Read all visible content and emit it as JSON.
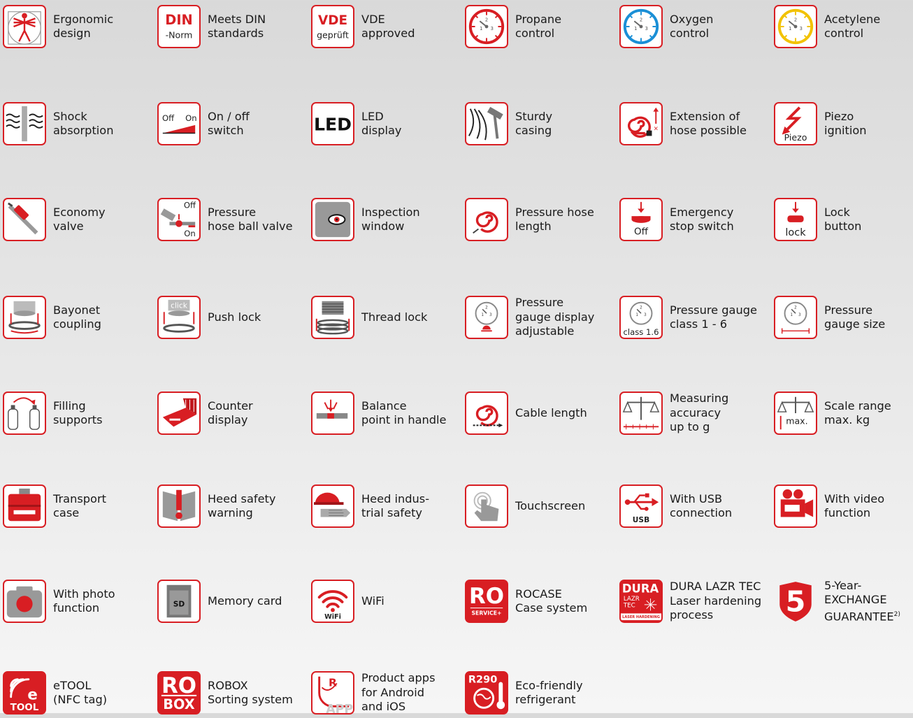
{
  "brand_color": "#d81e23",
  "features": [
    {
      "label": "Ergonomic\ndesign",
      "icon": "ergonomic-figure-icon"
    },
    {
      "label": "Meets DIN\nstandards",
      "icon": "din-norm-icon",
      "icon_text": [
        "DIN",
        "-Norm"
      ]
    },
    {
      "label": "VDE\napproved",
      "icon": "vde-icon",
      "icon_text": [
        "VDE",
        "geprüft"
      ]
    },
    {
      "label": "Propane\ncontrol",
      "icon": "propane-gauge-icon",
      "icon_color": "#d81e23"
    },
    {
      "label": "Oxygen\ncontrol",
      "icon": "oxygen-gauge-icon",
      "icon_color": "#1a8fd6"
    },
    {
      "label": "Acetylene\ncontrol",
      "icon": "acetylene-gauge-icon",
      "icon_color": "#f2c200"
    },
    {
      "label": "Shock\nabsorption",
      "icon": "shock-absorption-icon"
    },
    {
      "label": "On / off\nswitch",
      "icon": "on-off-switch-icon",
      "icon_text": [
        "Off",
        "On"
      ]
    },
    {
      "label": "LED\ndisplay",
      "icon": "led-icon",
      "icon_text": [
        "LED"
      ]
    },
    {
      "label": "Sturdy\ncasing",
      "icon": "hammer-icon"
    },
    {
      "label": "Extension of\nhose possible",
      "icon": "hose-extension-icon"
    },
    {
      "label": "Piezo\nignition",
      "icon": "piezo-icon",
      "icon_text": [
        "Piezo"
      ]
    },
    {
      "label": "Economy\nvalve",
      "icon": "economy-valve-icon"
    },
    {
      "label": "Pressure\nhose ball valve",
      "icon": "ball-valve-icon",
      "icon_text": [
        "Off",
        "On"
      ]
    },
    {
      "label": "Inspection\nwindow",
      "icon": "eye-icon"
    },
    {
      "label": "Pressure hose\nlength",
      "icon": "hose-coil-icon"
    },
    {
      "label": "Emergency\nstop switch",
      "icon": "emergency-stop-icon",
      "icon_text": [
        "Off"
      ]
    },
    {
      "label": "Lock\nbutton",
      "icon": "lock-button-icon",
      "icon_text": [
        "lock"
      ]
    },
    {
      "label": "Bayonet\ncoupling",
      "icon": "bayonet-coupling-icon"
    },
    {
      "label": "Push lock",
      "icon": "push-lock-icon",
      "icon_text": [
        "click"
      ]
    },
    {
      "label": "Thread lock",
      "icon": "thread-lock-icon"
    },
    {
      "label": "Pressure\ngauge display\nadjustable",
      "icon": "gauge-adjustable-icon"
    },
    {
      "label": "Pressure gauge\nclass 1 - 6",
      "icon": "gauge-class-icon",
      "icon_text": [
        "class 1.6"
      ]
    },
    {
      "label": "Pressure\ngauge size",
      "icon": "gauge-size-icon"
    },
    {
      "label": "Filling\nsupports",
      "icon": "filling-bottles-icon"
    },
    {
      "label": "Counter\ndisplay",
      "icon": "counter-display-icon"
    },
    {
      "label": "Balance\npoint in handle",
      "icon": "balance-point-icon"
    },
    {
      "label": "Cable length",
      "icon": "cable-coil-icon"
    },
    {
      "label": "Measuring\naccuracy\nup to g",
      "icon": "scale-accuracy-icon"
    },
    {
      "label": "Scale range\nmax. kg",
      "icon": "scale-range-icon",
      "icon_text": [
        "max."
      ]
    },
    {
      "label": "Transport\ncase",
      "icon": "transport-case-icon"
    },
    {
      "label": "Heed safety\nwarning",
      "icon": "safety-warning-icon"
    },
    {
      "label": "Heed indus-\ntrial safety",
      "icon": "helmet-gloves-icon"
    },
    {
      "label": "Touchscreen",
      "icon": "touchscreen-icon"
    },
    {
      "label": "With USB\nconnection",
      "icon": "usb-icon",
      "icon_text": [
        "USB"
      ]
    },
    {
      "label": "With video\nfunction",
      "icon": "video-camera-icon"
    },
    {
      "label": "With photo\nfunction",
      "icon": "photo-camera-icon"
    },
    {
      "label": "Memory card",
      "icon": "memory-card-icon",
      "icon_text": [
        "SD"
      ]
    },
    {
      "label": "WiFi",
      "icon": "wifi-icon",
      "icon_text": [
        "WiFi"
      ]
    },
    {
      "label": "ROCASE\nCase system",
      "icon": "rocase-icon",
      "icon_text": [
        "RO",
        "SERVICE+"
      ]
    },
    {
      "label": "DURA LAZR TEC\nLaser hardening\nprocess",
      "icon": "dura-lazr-icon",
      "icon_text": [
        "DURA",
        "LAZR",
        "TEC",
        "LASER HARDENING"
      ]
    },
    {
      "label": "5-Year-\nEXCHANGE\nGUARANTEE",
      "label_sup": "2)",
      "icon": "five-year-shield-icon",
      "icon_text": [
        "5"
      ]
    },
    {
      "label": "eTOOL\n(NFC tag)",
      "icon": "etool-nfc-icon",
      "icon_text": [
        "e",
        "TOOL"
      ]
    },
    {
      "label": "ROBOX\nSorting system",
      "icon": "robox-icon",
      "icon_text": [
        "RO",
        "BOX"
      ]
    },
    {
      "label": "Product apps\nfor Android\nand iOS",
      "icon": "app-icon",
      "icon_text": [
        "R",
        "APP"
      ]
    },
    {
      "label": "Eco-friendly\nrefrigerant",
      "icon": "r290-refrigerant-icon",
      "icon_text": [
        "R290"
      ]
    }
  ]
}
